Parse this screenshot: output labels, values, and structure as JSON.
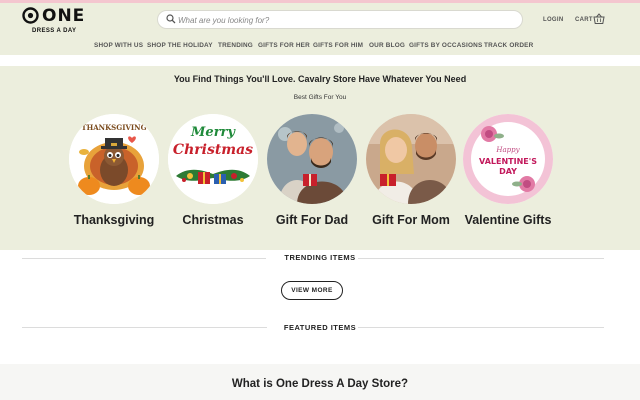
{
  "brand": {
    "name": "ONE",
    "tagline": "DRESS A DAY"
  },
  "search": {
    "placeholder": "What are you looking for?"
  },
  "header_links": {
    "login": "LOGIN",
    "cart": "CART"
  },
  "nav": {
    "items": [
      "SHOP WITH US",
      "SHOP THE HOLIDAY",
      "TRENDING",
      "GIFTS FOR HER",
      "GIFTS FOR HIM",
      "OUR BLOG",
      "GIFTS BY OCCASIONS",
      "TRACK ORDER"
    ]
  },
  "hero": {
    "title": "You Find Things You'll Love. Cavalry Store Have Whatever You Need",
    "subtitle": "Best Gifts For You"
  },
  "categories": [
    {
      "label": "Thanksgiving",
      "art_text": "THANKSGIVING"
    },
    {
      "label": "Christmas",
      "art_text_1": "Merry",
      "art_text_2": "Christmas"
    },
    {
      "label": "Gift For Dad"
    },
    {
      "label": "Gift For Mom"
    },
    {
      "label": "Valentine Gifts",
      "art_text_1": "Happy",
      "art_text_2": "VALENTINE'S",
      "art_text_3": "DAY"
    }
  ],
  "trending": {
    "title": "TRENDING ITEMS",
    "button": "VIEW MORE"
  },
  "featured": {
    "title": "FEATURED ITEMS"
  },
  "about": {
    "title": "What is One Dress A Day Store?"
  },
  "colors": {
    "header_bg": "#eceedd",
    "accent_pink": "#f4c6cf",
    "text": "#222222"
  }
}
